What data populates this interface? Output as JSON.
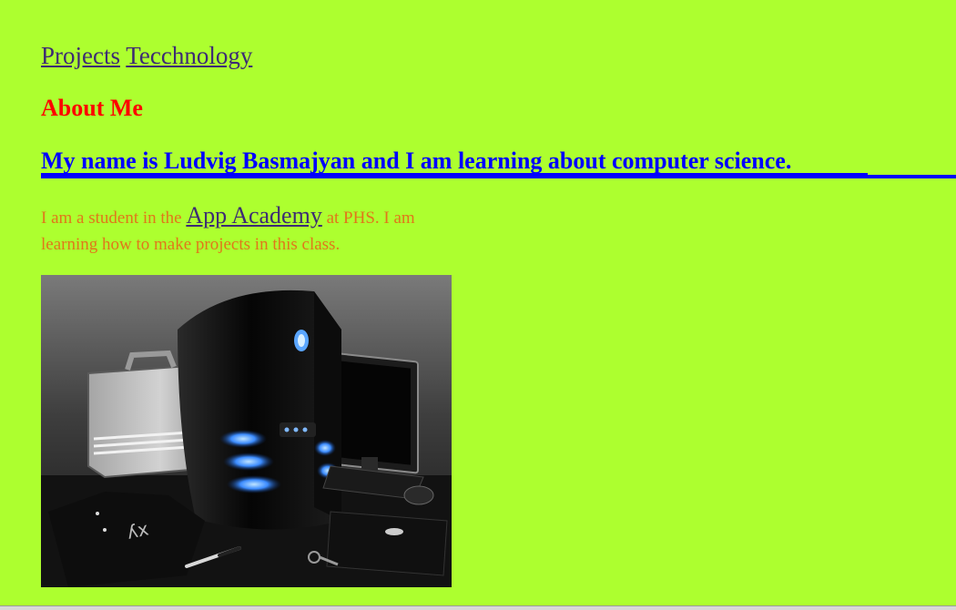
{
  "nav": {
    "projects": "Projects",
    "technology": "Tecchnology"
  },
  "about_heading": "About Me",
  "intro": "My name is Ludvig Basmajyan and I am learning about computer science.",
  "para": {
    "before": "I am a student in the ",
    "link": "App Academy",
    "after": " at PHS. I am learning how to make projects in this class."
  },
  "colors": {
    "background": "#adff2f",
    "heading": "#ff0000",
    "intro": "#0000ff",
    "paragraph": "#e0771a",
    "link": "#3d2b74"
  }
}
